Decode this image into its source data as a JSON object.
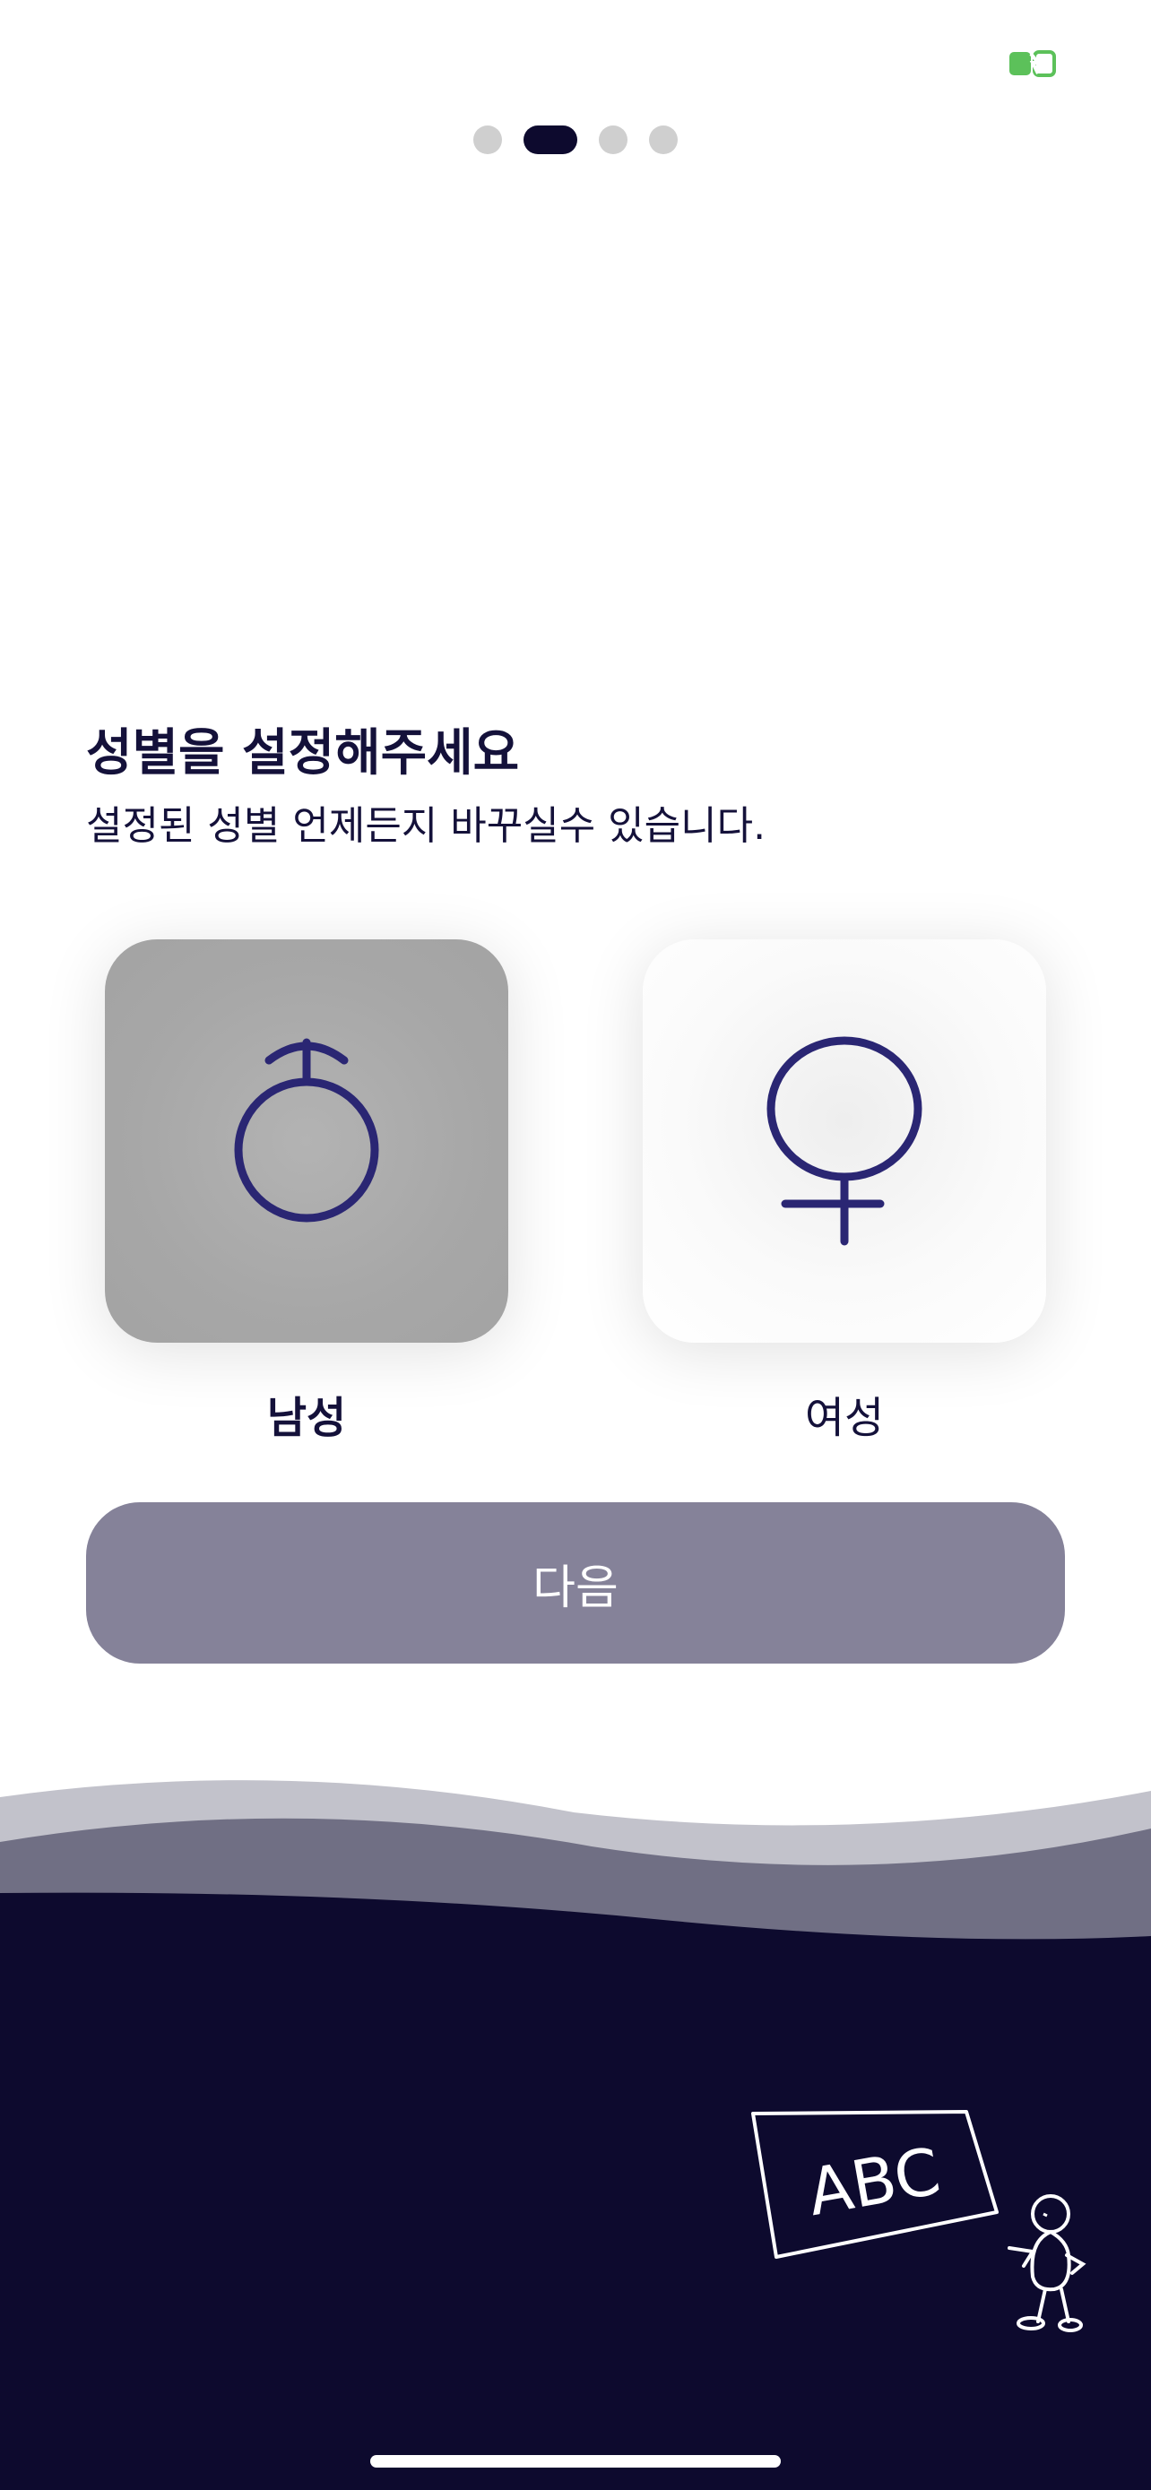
{
  "status_bar": {
    "battery_icon": "battery-charging-icon",
    "battery_color": "#5cc15a"
  },
  "page_indicator": {
    "total_pages": 4,
    "current_page": 2
  },
  "header": {
    "title": "성별을 설정해주세요",
    "subtitle": "설정된 성별 언제든지 바꾸실수 있습니다."
  },
  "options": [
    {
      "label": "남성",
      "icon": "male-symbol-icon",
      "selected": true
    },
    {
      "label": "여성",
      "icon": "female-symbol-icon",
      "selected": false
    }
  ],
  "next_button": {
    "label": "다음"
  },
  "illustration": {
    "chalkboard_text": "ABC",
    "icon": "chalkboard-teacher-illustration"
  },
  "colors": {
    "primary_dark": "#0d0a2e",
    "button_disabled": "#858299",
    "selected_card": "#a7a7a7",
    "symbol_ink": "#2a2673"
  }
}
